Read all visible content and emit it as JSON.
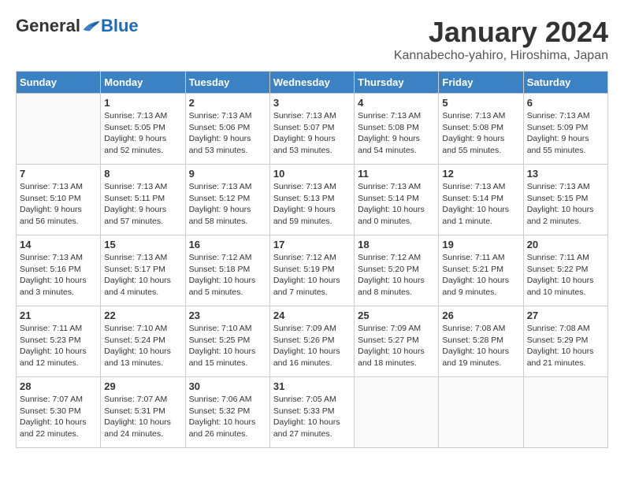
{
  "logo": {
    "general": "General",
    "blue": "Blue"
  },
  "header": {
    "month": "January 2024",
    "location": "Kannabecho-yahiro, Hiroshima, Japan"
  },
  "weekdays": [
    "Sunday",
    "Monday",
    "Tuesday",
    "Wednesday",
    "Thursday",
    "Friday",
    "Saturday"
  ],
  "weeks": [
    [
      {
        "day": "",
        "info": ""
      },
      {
        "day": "1",
        "info": "Sunrise: 7:13 AM\nSunset: 5:05 PM\nDaylight: 9 hours\nand 52 minutes."
      },
      {
        "day": "2",
        "info": "Sunrise: 7:13 AM\nSunset: 5:06 PM\nDaylight: 9 hours\nand 53 minutes."
      },
      {
        "day": "3",
        "info": "Sunrise: 7:13 AM\nSunset: 5:07 PM\nDaylight: 9 hours\nand 53 minutes."
      },
      {
        "day": "4",
        "info": "Sunrise: 7:13 AM\nSunset: 5:08 PM\nDaylight: 9 hours\nand 54 minutes."
      },
      {
        "day": "5",
        "info": "Sunrise: 7:13 AM\nSunset: 5:08 PM\nDaylight: 9 hours\nand 55 minutes."
      },
      {
        "day": "6",
        "info": "Sunrise: 7:13 AM\nSunset: 5:09 PM\nDaylight: 9 hours\nand 55 minutes."
      }
    ],
    [
      {
        "day": "7",
        "info": "Sunrise: 7:13 AM\nSunset: 5:10 PM\nDaylight: 9 hours\nand 56 minutes."
      },
      {
        "day": "8",
        "info": "Sunrise: 7:13 AM\nSunset: 5:11 PM\nDaylight: 9 hours\nand 57 minutes."
      },
      {
        "day": "9",
        "info": "Sunrise: 7:13 AM\nSunset: 5:12 PM\nDaylight: 9 hours\nand 58 minutes."
      },
      {
        "day": "10",
        "info": "Sunrise: 7:13 AM\nSunset: 5:13 PM\nDaylight: 9 hours\nand 59 minutes."
      },
      {
        "day": "11",
        "info": "Sunrise: 7:13 AM\nSunset: 5:14 PM\nDaylight: 10 hours\nand 0 minutes."
      },
      {
        "day": "12",
        "info": "Sunrise: 7:13 AM\nSunset: 5:14 PM\nDaylight: 10 hours\nand 1 minute."
      },
      {
        "day": "13",
        "info": "Sunrise: 7:13 AM\nSunset: 5:15 PM\nDaylight: 10 hours\nand 2 minutes."
      }
    ],
    [
      {
        "day": "14",
        "info": "Sunrise: 7:13 AM\nSunset: 5:16 PM\nDaylight: 10 hours\nand 3 minutes."
      },
      {
        "day": "15",
        "info": "Sunrise: 7:13 AM\nSunset: 5:17 PM\nDaylight: 10 hours\nand 4 minutes."
      },
      {
        "day": "16",
        "info": "Sunrise: 7:12 AM\nSunset: 5:18 PM\nDaylight: 10 hours\nand 5 minutes."
      },
      {
        "day": "17",
        "info": "Sunrise: 7:12 AM\nSunset: 5:19 PM\nDaylight: 10 hours\nand 7 minutes."
      },
      {
        "day": "18",
        "info": "Sunrise: 7:12 AM\nSunset: 5:20 PM\nDaylight: 10 hours\nand 8 minutes."
      },
      {
        "day": "19",
        "info": "Sunrise: 7:11 AM\nSunset: 5:21 PM\nDaylight: 10 hours\nand 9 minutes."
      },
      {
        "day": "20",
        "info": "Sunrise: 7:11 AM\nSunset: 5:22 PM\nDaylight: 10 hours\nand 10 minutes."
      }
    ],
    [
      {
        "day": "21",
        "info": "Sunrise: 7:11 AM\nSunset: 5:23 PM\nDaylight: 10 hours\nand 12 minutes."
      },
      {
        "day": "22",
        "info": "Sunrise: 7:10 AM\nSunset: 5:24 PM\nDaylight: 10 hours\nand 13 minutes."
      },
      {
        "day": "23",
        "info": "Sunrise: 7:10 AM\nSunset: 5:25 PM\nDaylight: 10 hours\nand 15 minutes."
      },
      {
        "day": "24",
        "info": "Sunrise: 7:09 AM\nSunset: 5:26 PM\nDaylight: 10 hours\nand 16 minutes."
      },
      {
        "day": "25",
        "info": "Sunrise: 7:09 AM\nSunset: 5:27 PM\nDaylight: 10 hours\nand 18 minutes."
      },
      {
        "day": "26",
        "info": "Sunrise: 7:08 AM\nSunset: 5:28 PM\nDaylight: 10 hours\nand 19 minutes."
      },
      {
        "day": "27",
        "info": "Sunrise: 7:08 AM\nSunset: 5:29 PM\nDaylight: 10 hours\nand 21 minutes."
      }
    ],
    [
      {
        "day": "28",
        "info": "Sunrise: 7:07 AM\nSunset: 5:30 PM\nDaylight: 10 hours\nand 22 minutes."
      },
      {
        "day": "29",
        "info": "Sunrise: 7:07 AM\nSunset: 5:31 PM\nDaylight: 10 hours\nand 24 minutes."
      },
      {
        "day": "30",
        "info": "Sunrise: 7:06 AM\nSunset: 5:32 PM\nDaylight: 10 hours\nand 26 minutes."
      },
      {
        "day": "31",
        "info": "Sunrise: 7:05 AM\nSunset: 5:33 PM\nDaylight: 10 hours\nand 27 minutes."
      },
      {
        "day": "",
        "info": ""
      },
      {
        "day": "",
        "info": ""
      },
      {
        "day": "",
        "info": ""
      }
    ]
  ]
}
